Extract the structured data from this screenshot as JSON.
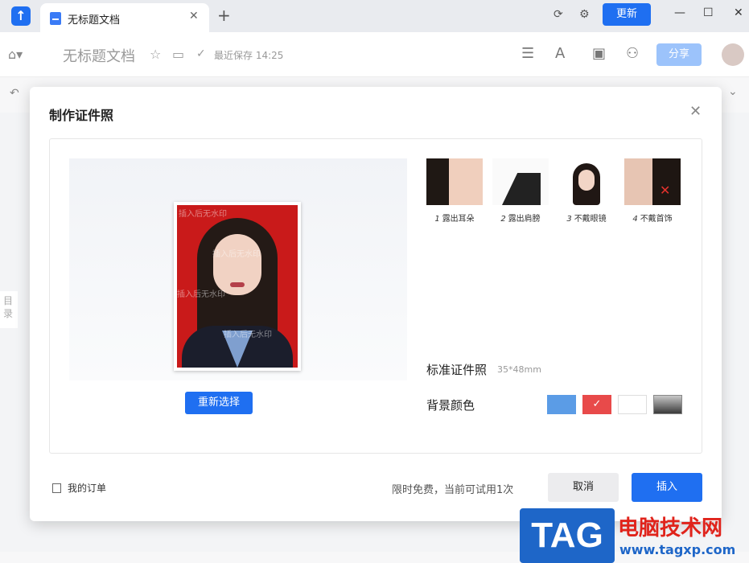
{
  "app": {
    "tab_title": "无标题文档",
    "update_label": "更新"
  },
  "toolbar": {
    "doc_title": "无标题文档",
    "saved_status": "最近保存 14:25",
    "share_label": "分享"
  },
  "side": {
    "toc_label": "目录"
  },
  "dialog": {
    "title": "制作证件照",
    "reselect_label": "重新选择",
    "watermark": "插入后无水印",
    "tips": [
      {
        "num": "1",
        "label": "露出耳朵"
      },
      {
        "num": "2",
        "label": "露出肩膀"
      },
      {
        "num": "3",
        "label": "不戴眼镜"
      },
      {
        "num": "4",
        "label": "不戴首饰"
      }
    ],
    "standard_label": "标准证件照",
    "standard_size": "35*48mm",
    "bg_color_label": "背景颜色",
    "swatches": [
      {
        "color": "#5b9ce6",
        "selected": false
      },
      {
        "color": "#e84a4a",
        "selected": true
      },
      {
        "color": "#ffffff",
        "selected": false
      },
      {
        "color": "gradient-gray",
        "selected": false
      }
    ],
    "my_orders_label": "我的订单",
    "trial_text": "限时免费，当前可试用1次",
    "cancel_label": "取消",
    "insert_label": "插入"
  },
  "watermark_stamp": {
    "logo": "TAG",
    "site_name": "电脑技术网",
    "url": "www.tagxp.com"
  }
}
